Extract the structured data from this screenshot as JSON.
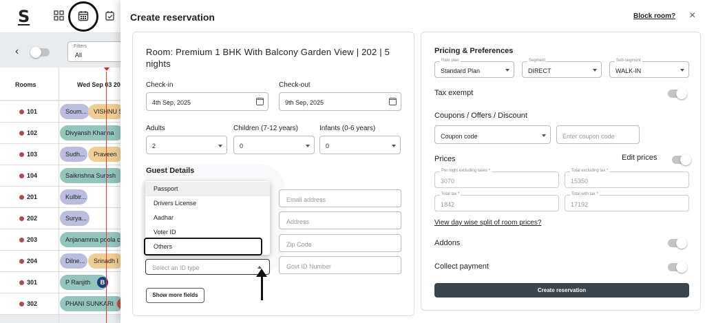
{
  "app": {
    "logo": "S"
  },
  "filters": {
    "label": "Filters",
    "value": "All"
  },
  "grid": {
    "rooms_header": "Rooms",
    "date_header": "Wed Sep 03 20",
    "rows": [
      {
        "room": "101",
        "pills": [
          {
            "text": "Soum...",
            "color": "lav"
          },
          {
            "text": "VISHNU S",
            "color": "tan"
          }
        ]
      },
      {
        "room": "102",
        "pills": [
          {
            "text": "Divyansh Khanna",
            "color": "teal"
          }
        ]
      },
      {
        "room": "103",
        "pills": [
          {
            "text": "Sudh...",
            "color": "lav"
          },
          {
            "text": "Praveen",
            "color": "tan"
          }
        ]
      },
      {
        "room": "104",
        "pills": [
          {
            "text": "Saikrishna Suresh",
            "color": "teal"
          }
        ]
      },
      {
        "room": "201",
        "pills": [
          {
            "text": "Kulbir...",
            "color": "lav"
          }
        ]
      },
      {
        "room": "202",
        "pills": [
          {
            "text": "Surya...",
            "color": "lav"
          }
        ]
      },
      {
        "room": "203",
        "pills": [
          {
            "text": "Anjanamma poola c",
            "color": "teal"
          }
        ]
      },
      {
        "room": "204",
        "pills": [
          {
            "text": "Dilne...",
            "color": "lav"
          },
          {
            "text": "Srinadh I",
            "color": "tan"
          }
        ]
      },
      {
        "room": "301",
        "pills": [
          {
            "text": "P Ranjith",
            "color": "teal"
          }
        ],
        "badge": "B"
      },
      {
        "room": "302",
        "pills": [
          {
            "text": "PHANI SUNKARI",
            "color": "teal"
          }
        ]
      }
    ]
  },
  "modal": {
    "title": "Create reservation",
    "block_room": "Block room?",
    "close": "×"
  },
  "left": {
    "room_title": "Room: Premium 1 BHK With Balcony Garden View | 202 | 5 nights",
    "checkin_label": "Check-in",
    "checkin_value": "4th Sep, 2025",
    "checkout_label": "Check-out",
    "checkout_value": "9th Sep, 2025",
    "adults_label": "Adults",
    "adults_value": "2",
    "children_label": "Children (7-12 years)",
    "children_value": "0",
    "infants_label": "Infants (0-6 years)",
    "infants_value": "0",
    "guest_details": "Guest Details",
    "id_options": [
      "Passport",
      "Drivers License",
      "Aadhar",
      "Voter ID",
      "Others"
    ],
    "id_placeholder": "Select an ID type",
    "email_placeholder": "Email address",
    "address_placeholder": "Address",
    "zip_placeholder": "Zip Code",
    "govt_id_placeholder": "Govt ID Number",
    "show_more": "Show more fields"
  },
  "right": {
    "pricing_title": "Pricing & Preferences",
    "rate_plan_label": "Rate plan",
    "rate_plan_value": "Standard Plan",
    "segment_label": "Segment",
    "segment_value": "DIRECT",
    "subsegment_label": "Sub-segment",
    "subsegment_value": "WALK-IN",
    "tax_exempt": "Tax exempt",
    "coupons_title": "Coupons / Offers / Discount",
    "coupon_select": "Coupon code",
    "coupon_placeholder": "Enter coupon code",
    "prices_title": "Prices",
    "edit_prices": "Edit prices",
    "per_night_label": "Per night excluding taxes *",
    "per_night_value": "3070",
    "total_excl_label": "Total excluding tax *",
    "total_excl_value": "15350",
    "total_tax_label": "Total tax *",
    "total_tax_value": "1842",
    "total_with_label": "Total with tax *",
    "total_with_value": "17192",
    "day_wise_link": "View day wise split of room prices?",
    "addons": "Addons",
    "collect_payment": "Collect payment",
    "create_button": "Create reservation"
  }
}
